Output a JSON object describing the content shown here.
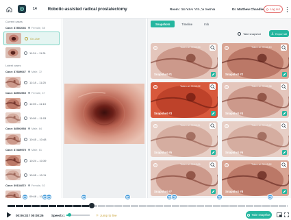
{
  "topbar": {
    "case_id": "14",
    "title": "Robotic-assisted radical prostatectomy",
    "room": "Room : מרפאה א', חדר ניתוח 14",
    "doctor": "Dr. Matthew Chandler",
    "logout_label": "Log out"
  },
  "sidebar": {
    "current_title": "Current cases",
    "current_case": {
      "id": "Case: 37851046",
      "meta": "Female, 68",
      "videos": [
        {
          "time": "On-Live",
          "live": true,
          "active": true
        },
        {
          "time": "11:24 – 11:31",
          "live": false
        }
      ]
    },
    "latest_title": "Latest cases",
    "cases": [
      {
        "id": "Case: 37689047",
        "meta": "Male, 72",
        "videos": [
          {
            "time": "11:18 – 11:25"
          }
        ]
      },
      {
        "id": "Case: 38591965",
        "meta": "Female, 47",
        "videos": [
          {
            "time": "11:03 – 11:13"
          },
          {
            "time": "10:50 – 11:03"
          }
        ]
      },
      {
        "id": "Case: 38591958",
        "meta": "Male, 84",
        "videos": [
          {
            "time": "10:45 – 10:48"
          }
        ]
      },
      {
        "id": "Case: 37489975",
        "meta": "Male, 61",
        "videos": [
          {
            "time": "10:24 – 10:39"
          },
          {
            "time": "10:05 – 10:11"
          }
        ]
      },
      {
        "id": "Case: 39134872",
        "meta": "Female, 52",
        "videos": [
          {
            "time": "09:48 – 10:02"
          }
        ]
      }
    ]
  },
  "tabs": [
    "Snapshots",
    "Timeline",
    "Info"
  ],
  "actions": {
    "take_snapshot": "Take snapshot",
    "export": "Export all"
  },
  "snapshots": [
    {
      "caption": "Snapshot #1",
      "ts": "Taken at: 00:02:34",
      "theme": "pale"
    },
    {
      "caption": "Snapshot #2",
      "ts": "Taken at: 00:04:19",
      "theme": "lesion"
    },
    {
      "caption": "Snapshot #3",
      "ts": "Taken at: 00:06:02",
      "theme": "red"
    },
    {
      "caption": "Snapshot #4",
      "ts": "Taken at: 00:07:38",
      "theme": "pale"
    },
    {
      "caption": "Snapshot #5",
      "ts": "Taken at: 00:09:11",
      "theme": "fold"
    },
    {
      "caption": "Snapshot #6",
      "ts": "Taken at: 00:10:47",
      "theme": "fold"
    },
    {
      "caption": "Snapshot #7",
      "ts": "Taken at: 00:12:05",
      "theme": "pale"
    },
    {
      "caption": "Snapshot #8",
      "ts": "Taken at: 00:13:52",
      "theme": "lesion"
    }
  ],
  "player": {
    "time": "00:06:32 / 00:08:26",
    "speed_label": "Speed:",
    "speed_value": "x1",
    "jump_label": "Jump to live",
    "snapshot_btn": "Take snapshot"
  },
  "colors": {
    "accent": "#25b69f",
    "marker": "#4ea0dc",
    "dark": "#1f2a33"
  }
}
